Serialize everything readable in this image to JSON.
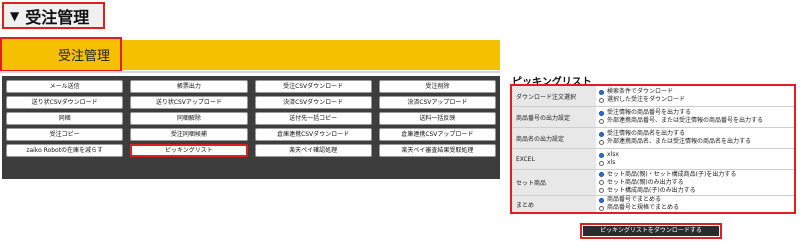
{
  "section": {
    "toggle_glyph": "▼",
    "title": "受注管理"
  },
  "tab": {
    "label": "受注管理",
    "color": "#f5c000"
  },
  "buttons": [
    "メール送信",
    "帳票出力",
    "受注CSVダウンロード",
    "受注削除",
    "送り状CSVダウンロード",
    "送り状CSVアップロード",
    "決済CSVダウンロード",
    "決済CSVアップロード",
    "同梱",
    "同梱解除",
    "送付先一括コピー",
    "送料一括反映",
    "受注コピー",
    "受注同梱候補",
    "倉庫連携CSVダウンロード",
    "倉庫連携CSVアップロード",
    "zaiko Robotの在庫を減らす",
    "ピッキングリスト",
    "楽天ペイ確認処理",
    "楽天ペイ審査結果受取処理"
  ],
  "picking": {
    "title": "ピッキングリスト",
    "rows": [
      {
        "label": "ダウンロード注文選択",
        "options": [
          {
            "text": "検索条件でダウンロード",
            "selected": true
          },
          {
            "text": "選択した受注をダウンロード",
            "selected": false
          }
        ]
      },
      {
        "label": "商品番号の出力設定",
        "options": [
          {
            "text": "受注情報の商品番号を出力する",
            "selected": true
          },
          {
            "text": "外部連携商品番号、または受注情報の商品番号を出力する",
            "selected": false
          }
        ]
      },
      {
        "label": "商品名の出力設定",
        "options": [
          {
            "text": "受注情報の商品名を出力する",
            "selected": true
          },
          {
            "text": "外部連携商品名、または受注情報の商品名を出力する",
            "selected": false
          }
        ]
      },
      {
        "label": "EXCEL",
        "options": [
          {
            "text": "xlsx",
            "selected": true
          },
          {
            "text": "xls",
            "selected": false
          }
        ]
      },
      {
        "label": "セット商品",
        "options": [
          {
            "text": "セット商品(親)・セット構成商品(子)を出力する",
            "selected": true
          },
          {
            "text": "セット商品(親)のみ出力する",
            "selected": false
          },
          {
            "text": "セット構成商品(子)のみ出力する",
            "selected": false
          }
        ]
      },
      {
        "label": "まとめ",
        "options": [
          {
            "text": "商品番号でまとめる",
            "selected": true
          },
          {
            "text": "商品番号と規格でまとめる",
            "selected": false
          }
        ]
      }
    ],
    "download_label": "ピッキングリストをダウンロードする"
  }
}
